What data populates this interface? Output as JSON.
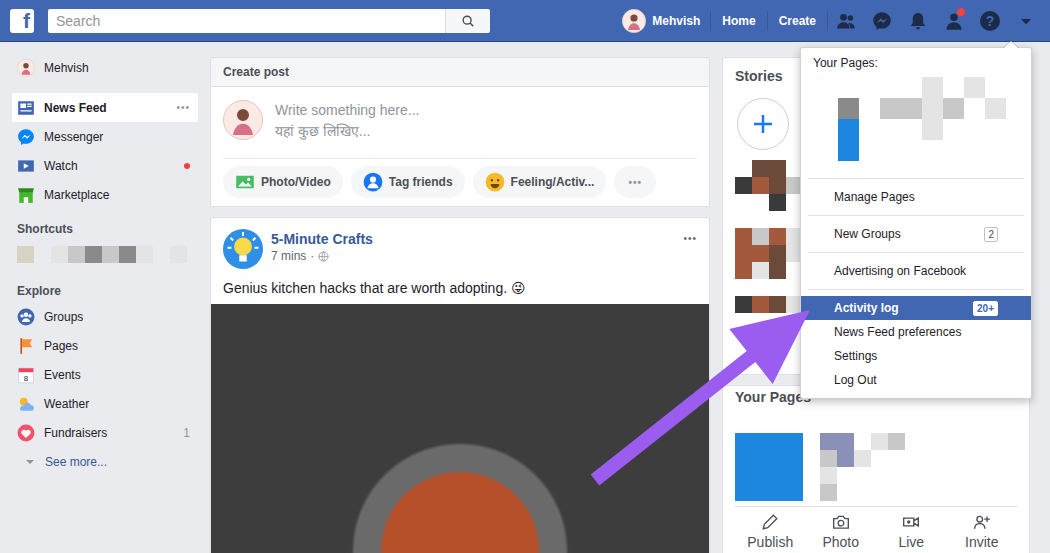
{
  "topbar": {
    "logo": "f",
    "search_placeholder": "Search",
    "profile_name": "Mehvish",
    "nav": [
      "Home",
      "Create"
    ],
    "requests_badge": true,
    "help": "?"
  },
  "sidebar": {
    "profile_name": "Mehvish",
    "items": [
      {
        "label": "News Feed",
        "selected": true,
        "dot": false,
        "more": "•••"
      },
      {
        "label": "Messenger",
        "selected": false,
        "dot": false,
        "more": ""
      },
      {
        "label": "Watch",
        "selected": false,
        "dot": true,
        "more": ""
      },
      {
        "label": "Marketplace",
        "selected": false,
        "dot": false,
        "more": ""
      }
    ],
    "shortcuts_title": "Shortcuts",
    "explore_title": "Explore",
    "explore": [
      {
        "label": "Groups",
        "count": "",
        "icon_text": ""
      },
      {
        "label": "Pages",
        "count": "",
        "icon_text": ""
      },
      {
        "label": "Events",
        "count": "",
        "icon_text": "8"
      },
      {
        "label": "Weather",
        "count": "",
        "icon_text": ""
      },
      {
        "label": "Fundraisers",
        "count": "1",
        "icon_text": ""
      }
    ],
    "see_more": "See more..."
  },
  "composer": {
    "title": "Create post",
    "placeholder": "Write something here...",
    "placeholder_hi": "यहां कुछ लिखिए...",
    "actions": [
      "Photo/Video",
      "Tag friends",
      "Feeling/Activ..."
    ],
    "more": "•••"
  },
  "post": {
    "author": "5-Minute Crafts",
    "time": "7 mins",
    "time_sep": "·",
    "text": "Genius kitchen hacks that are worth adopting.",
    "emoji": "😜",
    "more": "•••"
  },
  "right": {
    "stories_title": "Stories",
    "pages_title": "Your Pages",
    "page_actions": [
      "Publish",
      "Photo",
      "Live",
      "Invite"
    ]
  },
  "menu": {
    "header": "Your Pages:",
    "groups": [
      [
        {
          "label": "Manage Pages",
          "badge": "",
          "selected": false
        }
      ],
      [
        {
          "label": "New Groups",
          "badge": "2",
          "selected": false
        }
      ],
      [
        {
          "label": "Advertising on Facebook",
          "badge": "",
          "selected": false
        }
      ],
      [
        {
          "label": "Activity log",
          "badge": "20+",
          "selected": true
        },
        {
          "label": "News Feed preferences",
          "badge": "",
          "selected": false
        },
        {
          "label": "Settings",
          "badge": "",
          "selected": false
        },
        {
          "label": "Log Out",
          "badge": "",
          "selected": false
        }
      ]
    ]
  }
}
